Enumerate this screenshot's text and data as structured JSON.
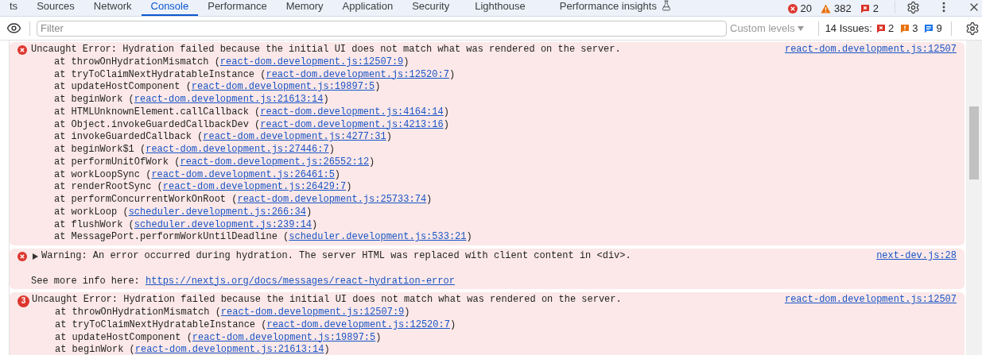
{
  "tabs": [
    {
      "label": "ts",
      "selected": false,
      "experimental": false
    },
    {
      "label": "Sources",
      "selected": false,
      "experimental": false
    },
    {
      "label": "Network",
      "selected": false,
      "experimental": false
    },
    {
      "label": "Console",
      "selected": true,
      "experimental": false
    },
    {
      "label": "Performance",
      "selected": false,
      "experimental": false
    },
    {
      "label": "Memory",
      "selected": false,
      "experimental": false
    },
    {
      "label": "Application",
      "selected": false,
      "experimental": false
    },
    {
      "label": "Security",
      "selected": false,
      "experimental": false
    },
    {
      "label": "Lighthouse",
      "selected": false,
      "experimental": false
    },
    {
      "label": "Performance insights",
      "selected": false,
      "experimental": true
    }
  ],
  "status_counts": [
    {
      "kind": "error",
      "count": "20"
    },
    {
      "kind": "warning",
      "count": "382"
    },
    {
      "kind": "issue",
      "count": "2"
    }
  ],
  "toolbar": {
    "filter": {
      "placeholder": "Filter"
    },
    "levels": "Custom levels",
    "issues_label": "14 Issues:",
    "issue_counts": [
      {
        "kind": "error",
        "count": "2"
      },
      {
        "kind": "warning",
        "count": "3"
      },
      {
        "kind": "info",
        "count": "9"
      }
    ]
  },
  "messages": [
    {
      "kind": "error",
      "text": "Uncaught Error: Hydration failed because the initial UI does not match what was rendered on the server.",
      "source": "react-dom.development.js:12507",
      "stack": [
        {
          "before": "at throwOnHydrationMismatch (",
          "link": "react-dom.development.js:12507:9",
          "after": ")"
        },
        {
          "before": "at tryToClaimNextHydratableInstance (",
          "link": "react-dom.development.js:12520:7",
          "after": ")"
        },
        {
          "before": "at updateHostComponent (",
          "link": "react-dom.development.js:19897:5",
          "after": ")"
        },
        {
          "before": "at beginWork (",
          "link": "react-dom.development.js:21613:14",
          "after": ")"
        },
        {
          "before": "at HTMLUnknownElement.callCallback (",
          "link": "react-dom.development.js:4164:14",
          "after": ")"
        },
        {
          "before": "at Object.invokeGuardedCallbackDev (",
          "link": "react-dom.development.js:4213:16",
          "after": ")"
        },
        {
          "before": "at invokeGuardedCallback (",
          "link": "react-dom.development.js:4277:31",
          "after": ")"
        },
        {
          "before": "at beginWork$1 (",
          "link": "react-dom.development.js:27446:7",
          "after": ")"
        },
        {
          "before": "at performUnitOfWork (",
          "link": "react-dom.development.js:26552:12",
          "after": ")"
        },
        {
          "before": "at workLoopSync (",
          "link": "react-dom.development.js:26461:5",
          "after": ")"
        },
        {
          "before": "at renderRootSync (",
          "link": "react-dom.development.js:26429:7",
          "after": ")"
        },
        {
          "before": "at performConcurrentWorkOnRoot (",
          "link": "react-dom.development.js:25733:74",
          "after": ")"
        },
        {
          "before": "at workLoop (",
          "link": "scheduler.development.js:266:34",
          "after": ")"
        },
        {
          "before": "at flushWork (",
          "link": "scheduler.development.js:239:14",
          "after": ")"
        },
        {
          "before": "at MessagePort.performWorkUntilDeadline (",
          "link": "scheduler.development.js:533:21",
          "after": ")"
        }
      ]
    },
    {
      "kind": "error",
      "expandable": true,
      "expanded": false,
      "text": "Warning: An error occurred during hydration. The server HTML was replaced with client content in <div>.",
      "source": "next-dev.js:28",
      "more": {
        "before": "See more info here: ",
        "link": "https://nextjs.org/docs/messages/react-hydration-error"
      }
    },
    {
      "kind": "error",
      "repeat": "3",
      "text": "Uncaught Error: Hydration failed because the initial UI does not match what was rendered on the server.",
      "source": "react-dom.development.js:12507",
      "stack": [
        {
          "before": "at throwOnHydrationMismatch (",
          "link": "react-dom.development.js:12507:9",
          "after": ")"
        },
        {
          "before": "at tryToClaimNextHydratableInstance (",
          "link": "react-dom.development.js:12520:7",
          "after": ")"
        },
        {
          "before": "at updateHostComponent (",
          "link": "react-dom.development.js:19897:5",
          "after": ")"
        },
        {
          "before": "at beginWork (",
          "link": "react-dom.development.js:21613:14",
          "after": ")"
        }
      ]
    }
  ]
}
